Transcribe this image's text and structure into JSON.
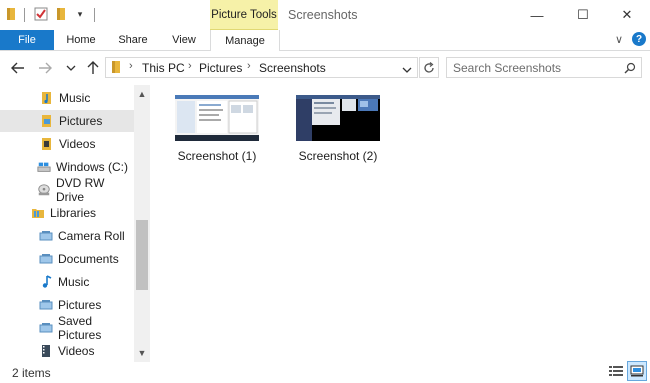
{
  "titlebar": {
    "contextual_tab": "Picture Tools",
    "title": "Screenshots",
    "minimize_glyph": "—",
    "maximize_glyph": "☐",
    "close_glyph": "✕"
  },
  "ribbon": {
    "tabs": [
      {
        "label": "File"
      },
      {
        "label": "Home"
      },
      {
        "label": "Share"
      },
      {
        "label": "View"
      },
      {
        "label": "Manage"
      }
    ],
    "expand_glyph": "∨",
    "help_glyph": "?"
  },
  "address": {
    "breadcrumb": [
      "This PC",
      "Pictures",
      "Screenshots"
    ],
    "search_placeholder": "Search Screenshots"
  },
  "nav": {
    "items": [
      {
        "label": "Music",
        "icon": "music-folder-icon"
      },
      {
        "label": "Pictures",
        "icon": "pictures-folder-icon",
        "selected": true
      },
      {
        "label": "Videos",
        "icon": "videos-folder-icon"
      },
      {
        "label": "Windows (C:)",
        "icon": "drive-icon"
      },
      {
        "label": "DVD RW Drive",
        "icon": "dvd-drive-icon"
      },
      {
        "label": "Libraries",
        "icon": "libraries-icon"
      },
      {
        "label": "Camera Roll",
        "icon": "library-icon"
      },
      {
        "label": "Documents",
        "icon": "library-icon"
      },
      {
        "label": "Music",
        "icon": "music-library-icon"
      },
      {
        "label": "Pictures",
        "icon": "library-icon"
      },
      {
        "label": "Saved Pictures",
        "icon": "library-icon"
      },
      {
        "label": "Videos",
        "icon": "video-library-icon"
      }
    ]
  },
  "files": [
    {
      "name": "Screenshot (1)"
    },
    {
      "name": "Screenshot (2)"
    }
  ],
  "status": {
    "count": "2 items"
  },
  "colors": {
    "accent": "#1979ca",
    "contextual": "#f6f1a8",
    "folder": "#e8b63c"
  }
}
